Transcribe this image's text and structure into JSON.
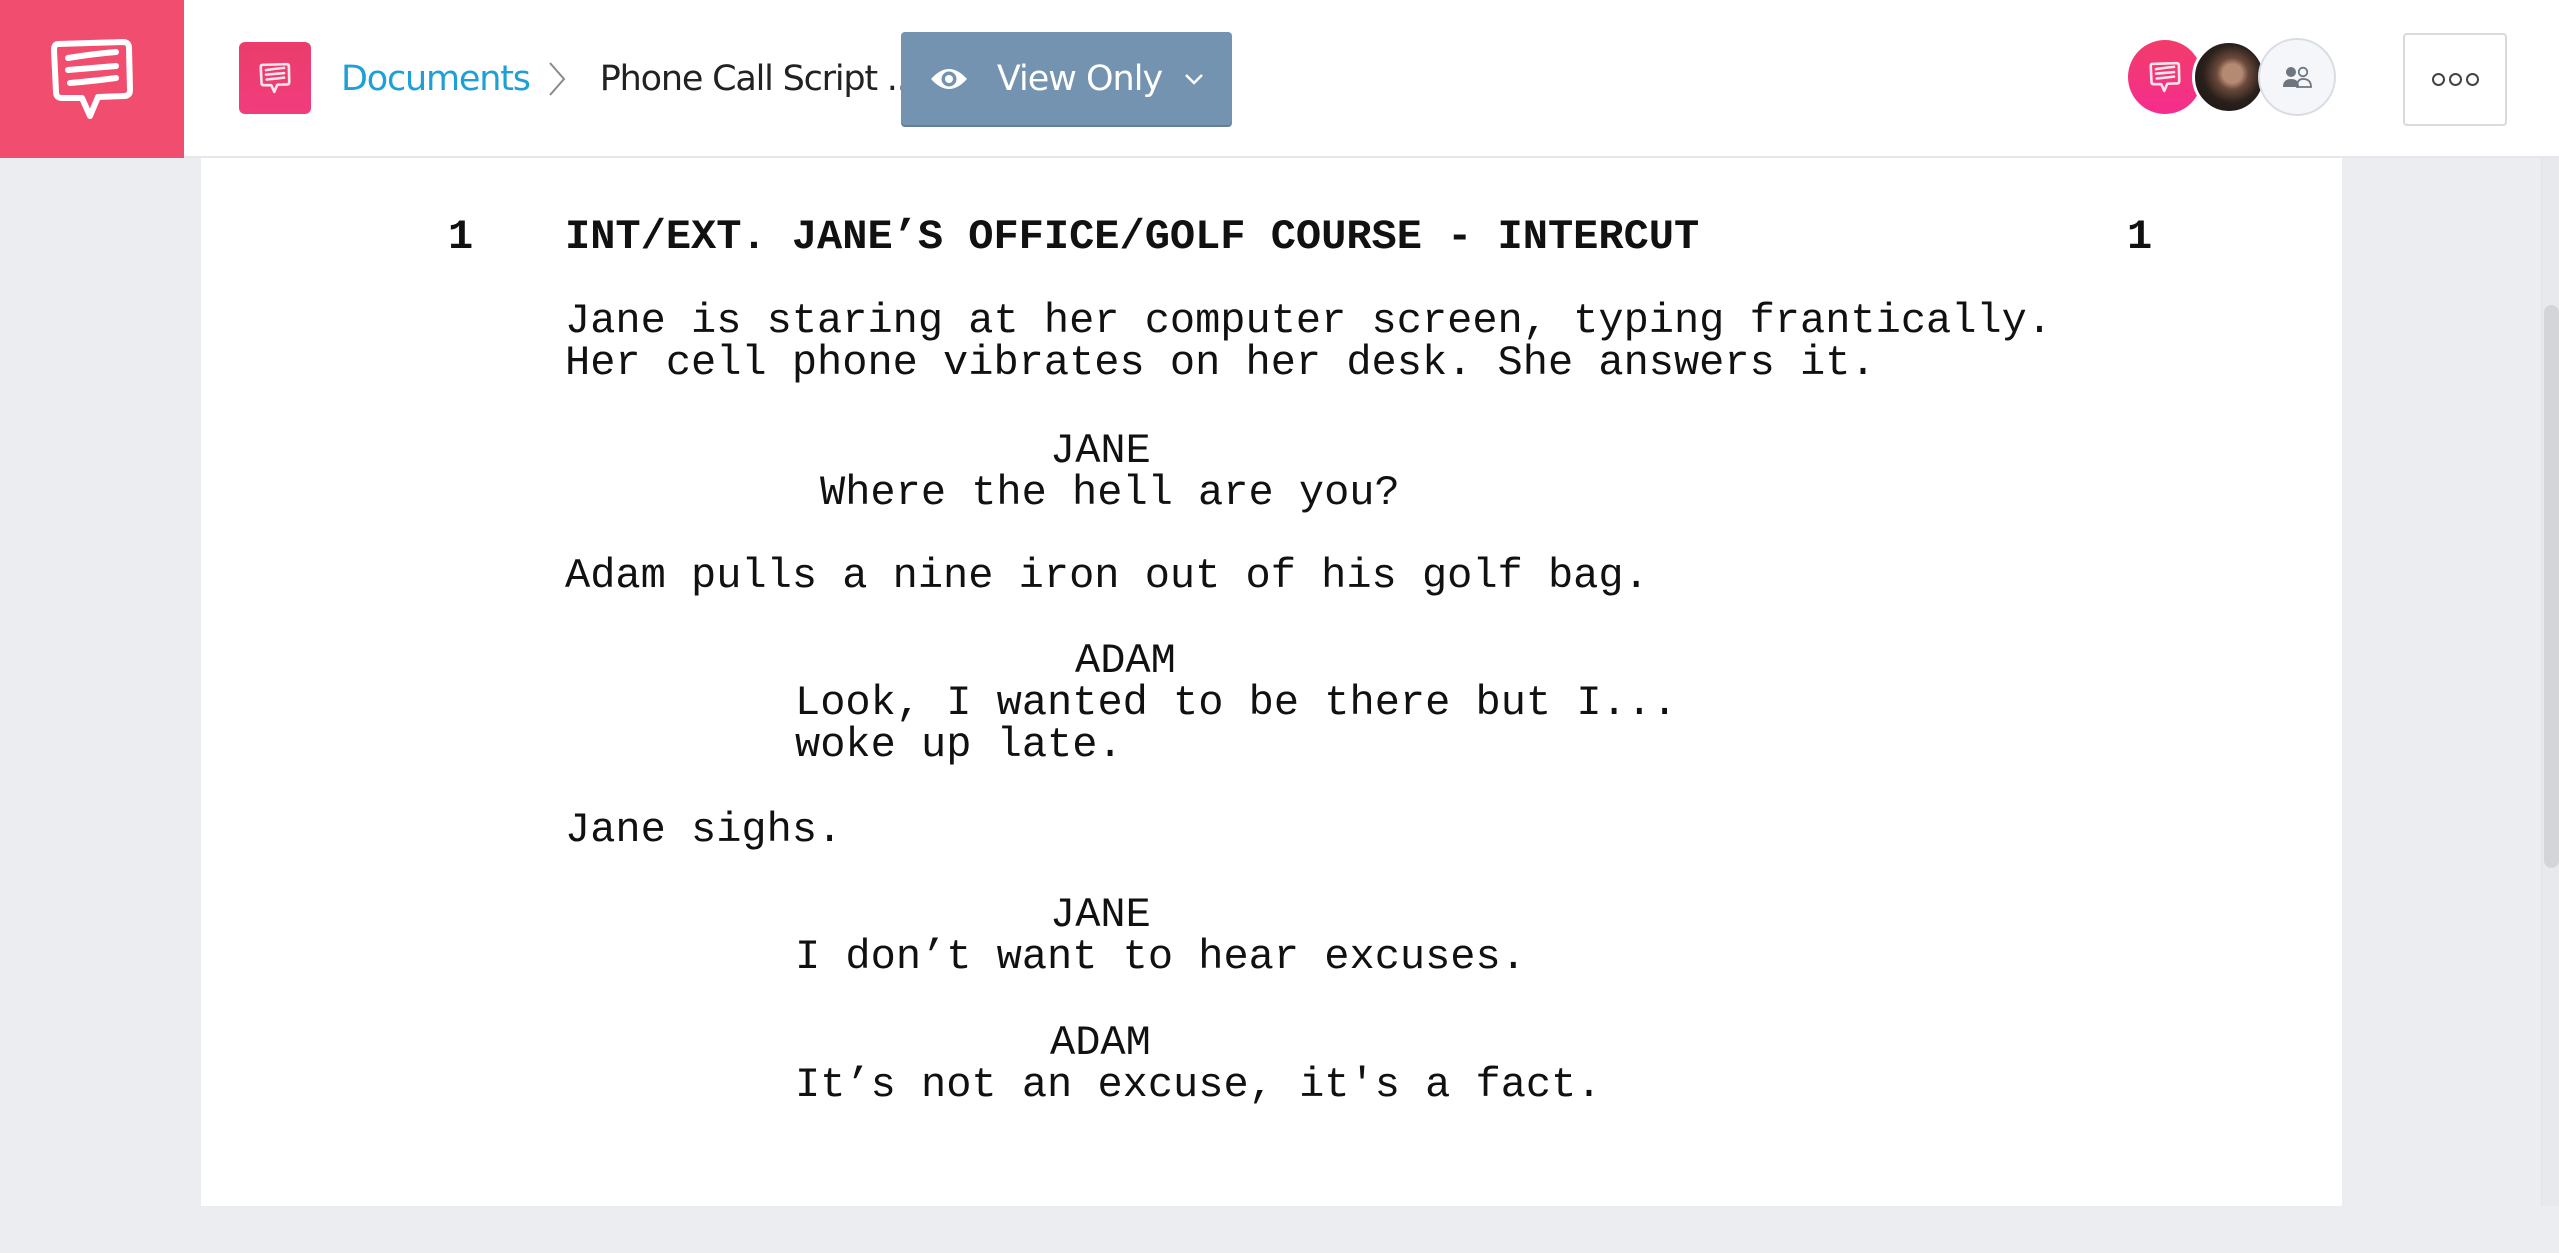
{
  "header": {
    "brand_icon": "speech-bubble-icon",
    "doc_icon": "speech-bubble-icon",
    "breadcrumb": {
      "root": "Documents",
      "separator_icon": "chevron-right-icon",
      "current": "Phone Call Script .."
    },
    "view_mode": {
      "icon": "eye-icon",
      "label": "View Only",
      "dropdown_icon": "chevron-down-icon"
    },
    "collaborators": [
      {
        "type": "brand",
        "icon": "speech-bubble-icon"
      },
      {
        "type": "photo",
        "alt": "user avatar"
      },
      {
        "type": "team",
        "icon": "users-icon"
      }
    ],
    "more_icon": "more-options-icon"
  },
  "colors": {
    "brand": "#f14d6e",
    "link": "#1ea0d6",
    "view_only_button": "#7393b0",
    "canvas_background": "#ecedf1"
  },
  "script": {
    "scene_number_left": "1",
    "scene_number_right": "1",
    "scene_heading": "INT/EXT. JANE’S OFFICE/GOLF COURSE - INTERCUT",
    "action_1": [
      "Jane is staring at her computer screen, typing frantically.",
      "Her cell phone vibrates on her desk. She answers it."
    ],
    "dialogue_1": {
      "character": "JANE",
      "lines": [
        "Where the hell are you?"
      ]
    },
    "action_2": "Adam pulls a nine iron out of his golf bag.",
    "dialogue_2": {
      "character": "ADAM",
      "lines": [
        "Look, I wanted to be there but I...",
        "woke up late."
      ]
    },
    "action_3": "Jane sighs.",
    "dialogue_3": {
      "character": "JANE",
      "lines": [
        "I don’t want to hear excuses."
      ]
    },
    "dialogue_4": {
      "character": "ADAM",
      "lines": [
        "It’s not an excuse, it's a fact."
      ]
    }
  }
}
